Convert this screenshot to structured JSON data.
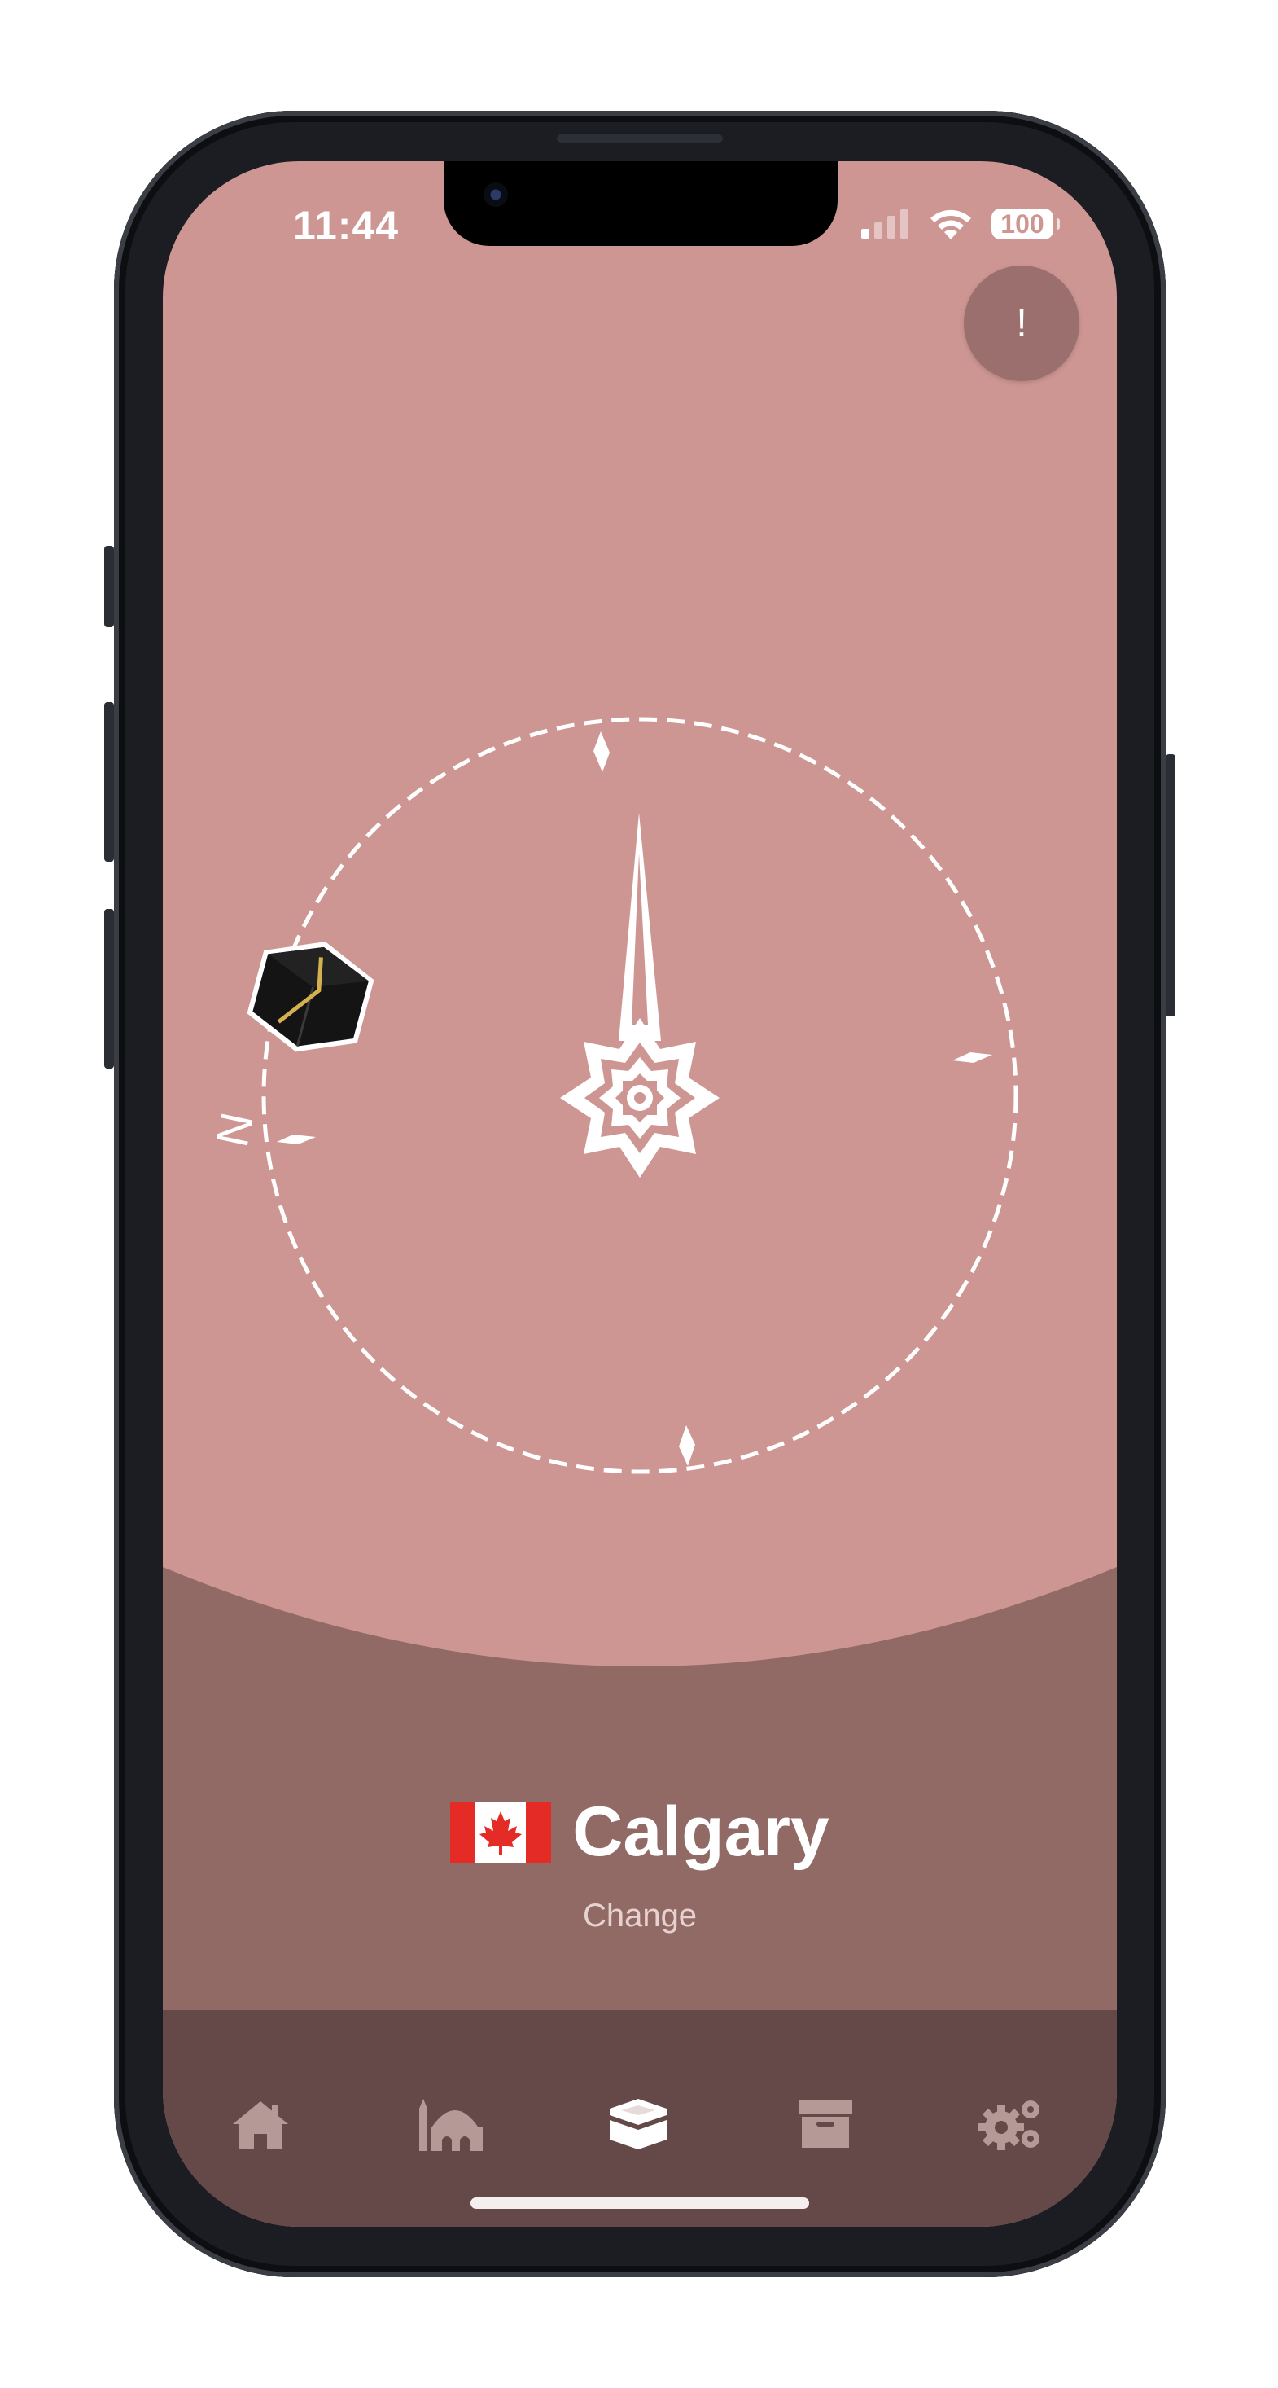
{
  "status_bar": {
    "time": "11:44",
    "battery": "100"
  },
  "info_button": {
    "label": "!"
  },
  "compass": {
    "north_label": "N"
  },
  "location": {
    "city": "Calgary",
    "country_flag": "canada-flag-icon",
    "change_label": "Change"
  },
  "tabs": [
    {
      "icon": "home-icon",
      "active": false
    },
    {
      "icon": "mosque-icon",
      "active": false
    },
    {
      "icon": "kaaba-icon",
      "active": true
    },
    {
      "icon": "archive-icon",
      "active": false
    },
    {
      "icon": "gears-icon",
      "active": false
    }
  ],
  "colors": {
    "background": "#ce9692",
    "panel": "#916a66",
    "tabbar": "#654848",
    "tab_inactive": "#b59996",
    "flag_red": "#e52b25"
  }
}
